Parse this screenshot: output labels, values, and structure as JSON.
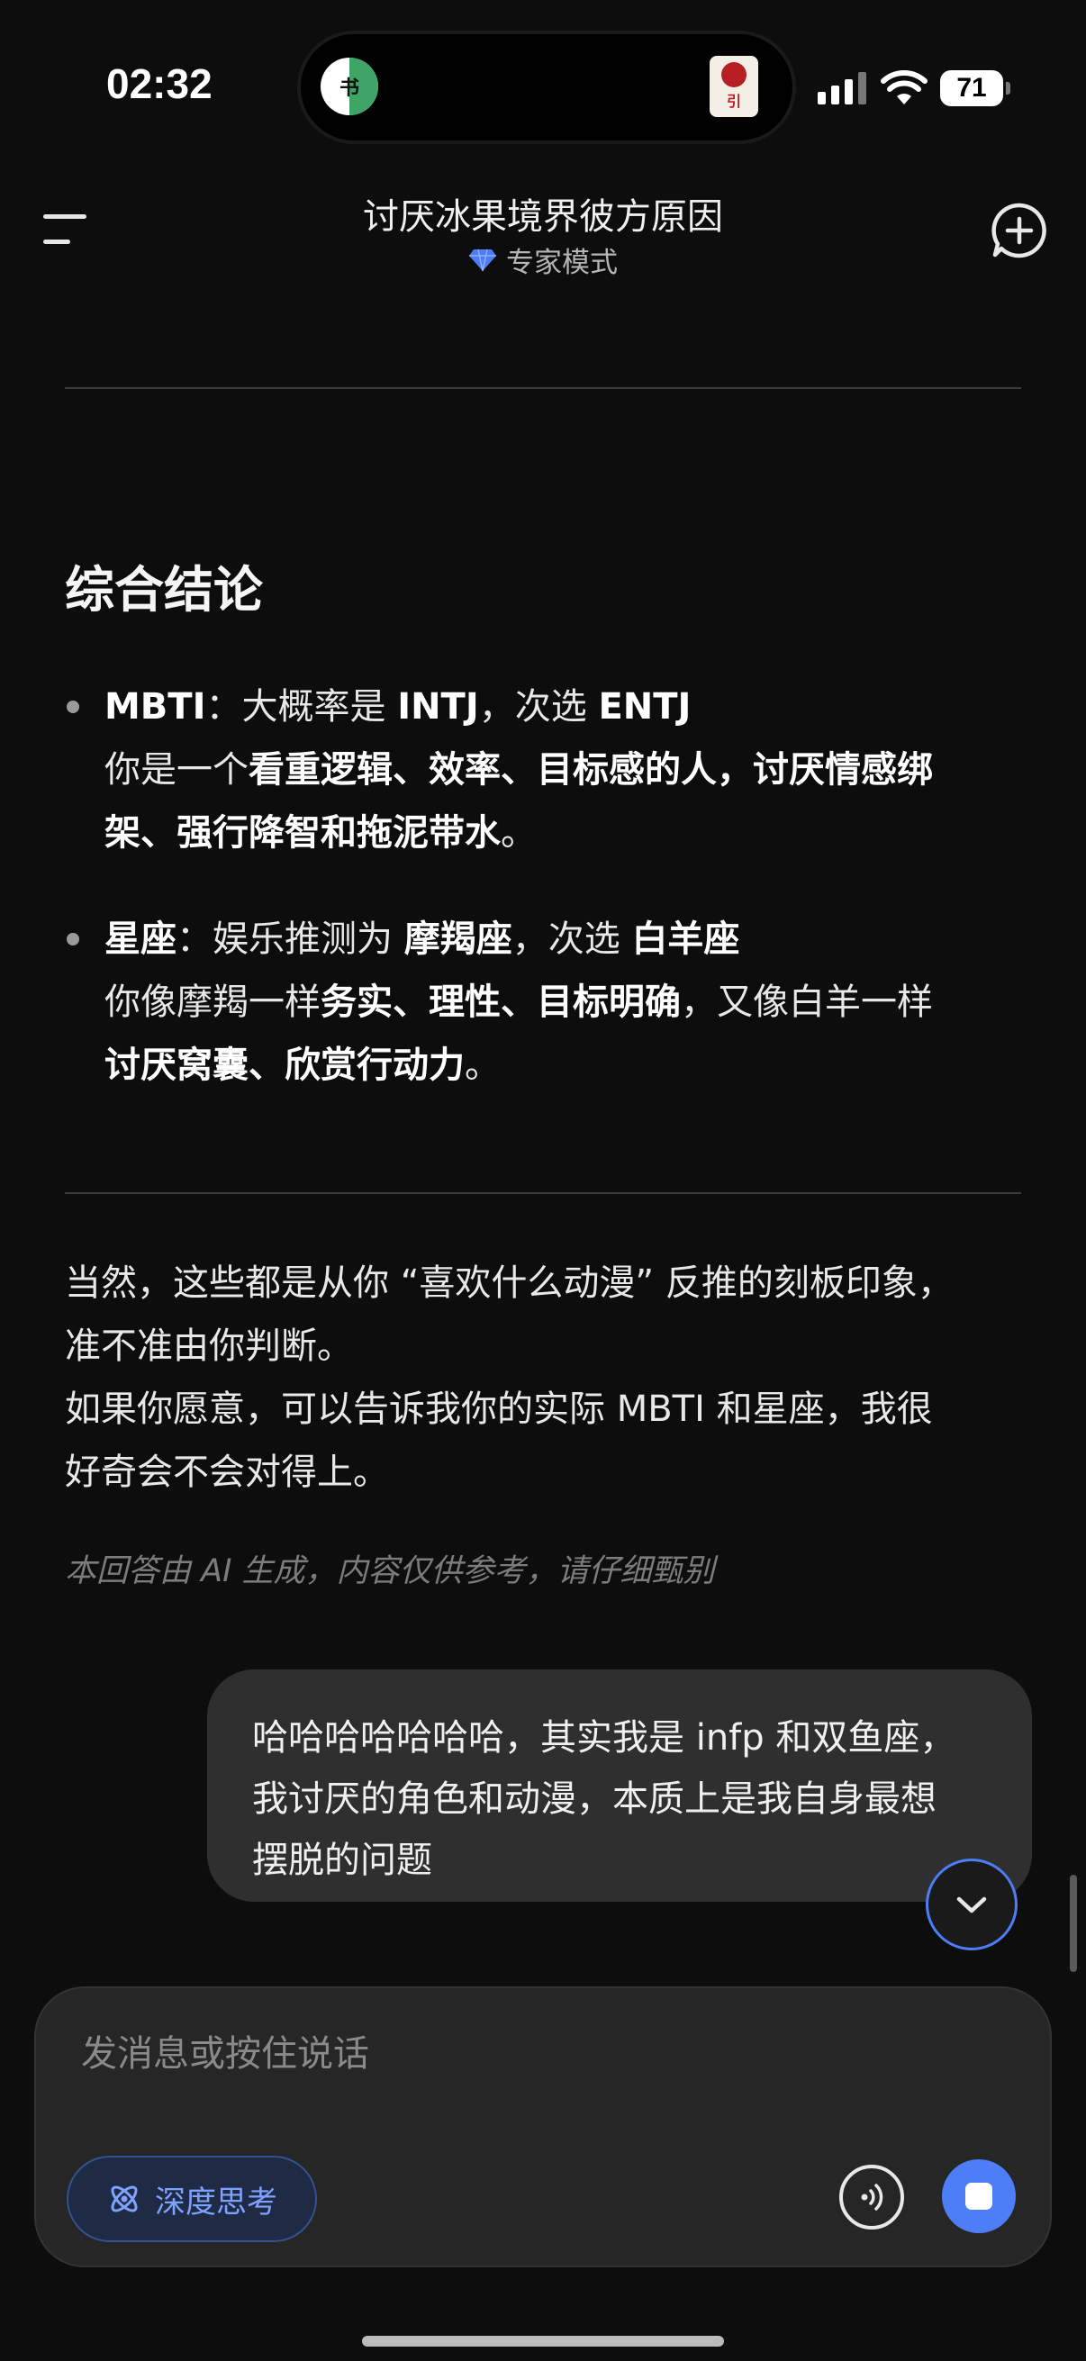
{
  "status_bar": {
    "time": "02:32",
    "battery": "71",
    "island_left_app_glyph": "书",
    "island_right_app_glyph": "引"
  },
  "header": {
    "title": "讨厌冰果境界彼方原因",
    "mode": "专家模式"
  },
  "content": {
    "heading": "综合结论",
    "bullets": [
      {
        "label": "MBTI",
        "sep": "：大概率是 ",
        "primary": "INTJ",
        "mid": "，次选 ",
        "secondary": "ENTJ",
        "line2_pre": "你是一个",
        "line2_bold": "看重逻辑、效率、目标感的人，讨厌情感绑",
        "line3_bold": "架、强行降智和拖泥带水",
        "line3_end": "。"
      },
      {
        "label": "星座",
        "sep": "：娱乐推测为 ",
        "primary": "摩羯座",
        "mid": "，次选 ",
        "secondary": "白羊座",
        "line2_pre": "你像摩羯一样",
        "line2_bold": "务实、理性、目标明确",
        "line2_post": "，又像白羊一样",
        "line3_bold": "讨厌窝囊、欣赏行动力",
        "line3_end": "。"
      }
    ],
    "closing_lines": [
      "当然，这些都是从你 “喜欢什么动漫” 反推的刻板印象，",
      "准不准由你判断。",
      "如果你愿意，可以告诉我你的实际 MBTI 和星座，我很",
      "好奇会不会对得上。"
    ],
    "disclaimer": "本回答由 AI 生成，内容仅供参考，请仔细甄别"
  },
  "user_message": {
    "lines": [
      "哈哈哈哈哈哈哈，其实我是 infp 和双鱼座，",
      "我讨厌的角色和动漫，本质上是我自身最想",
      "摆脱的问题"
    ]
  },
  "composer": {
    "placeholder": "发消息或按住说话",
    "deep_think_label": "深度思考"
  },
  "colors": {
    "accent": "#4d7df7",
    "background": "#0d0d0d",
    "bubble": "#2f2f2f",
    "panel": "#262626"
  },
  "icons": [
    "menu-icon",
    "diamond-icon",
    "new-chat-icon",
    "chevron-down-icon",
    "atom-icon",
    "voice-wave-icon",
    "stop-icon"
  ]
}
